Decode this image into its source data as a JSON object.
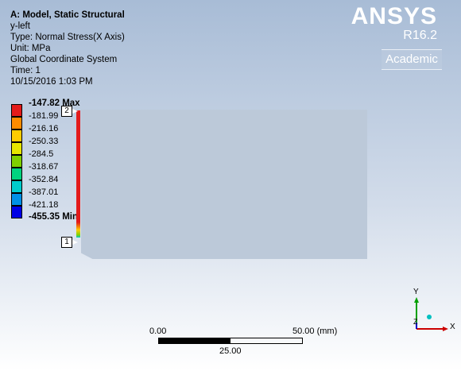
{
  "info": {
    "title": "A: Model, Static Structural",
    "lines": [
      "y-left",
      "Type: Normal Stress(X Axis)",
      "Unit: MPa",
      "Global Coordinate System",
      "Time: 1",
      "10/15/2016 1:03 PM"
    ]
  },
  "brand": {
    "name": "ANSYS",
    "version": "R16.2",
    "edition": "Academic"
  },
  "legend": {
    "max_label": "-147.82 Max",
    "min_label": "-455.35 Min",
    "values": [
      "-181.99",
      "-216.16",
      "-250.33",
      "-284.5",
      "-318.67",
      "-352.84",
      "-387.01",
      "-421.18"
    ],
    "colors": [
      "#e31b1b",
      "#ff8c00",
      "#ffcc00",
      "#e6e600",
      "#7fd000",
      "#00d27f",
      "#00cccc",
      "#0090e6",
      "#0000e6"
    ]
  },
  "probes": {
    "top": "2",
    "bottom": "1"
  },
  "scale": {
    "start": "0.00",
    "mid": "25.00",
    "end": "50.00 (mm)"
  },
  "triad": {
    "x": "X",
    "y": "Y",
    "z": "Z"
  }
}
